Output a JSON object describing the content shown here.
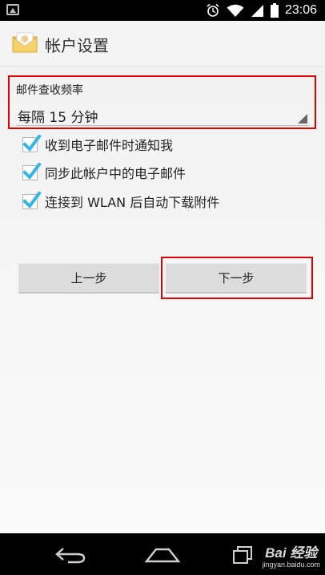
{
  "status_bar": {
    "time": "23:06",
    "icons": [
      "image-icon",
      "alarm-icon",
      "wifi-icon",
      "signal-icon",
      "battery-icon"
    ]
  },
  "action_bar": {
    "title": "帐户设置",
    "icon": "email-app-icon"
  },
  "settings": {
    "check_frequency": {
      "label": "邮件查收频率",
      "value": "每隔 15 分钟"
    },
    "options": [
      {
        "label": "收到电子邮件时通知我",
        "checked": true
      },
      {
        "label": "同步此帐户中的电子邮件",
        "checked": true
      },
      {
        "label": "连接到 WLAN 后自动下载附件",
        "checked": true
      }
    ]
  },
  "buttons": {
    "previous": "上一步",
    "next": "下一步"
  },
  "nav_bar": {
    "icons": [
      "back-icon",
      "home-icon",
      "recents-icon"
    ]
  },
  "watermark": {
    "main": "Bai 经验",
    "sub": "jingyan.baidu.com"
  },
  "colors": {
    "highlight": "#e00000",
    "checkbox_check": "#33b5e5",
    "button_bg": "#dcdcdc"
  }
}
